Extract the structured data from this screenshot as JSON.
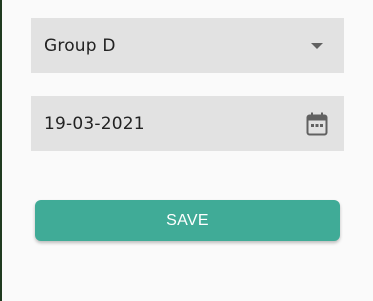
{
  "form": {
    "group_select": {
      "value": "Group D",
      "icon": "dropdown-arrow-icon"
    },
    "date_field": {
      "value": "19-03-2021",
      "icon": "calendar-icon"
    },
    "save_label": "SAVE"
  },
  "colors": {
    "field_background": "#e2e2e2",
    "save_button": "#40ab97",
    "page_background": "#fafafa"
  }
}
